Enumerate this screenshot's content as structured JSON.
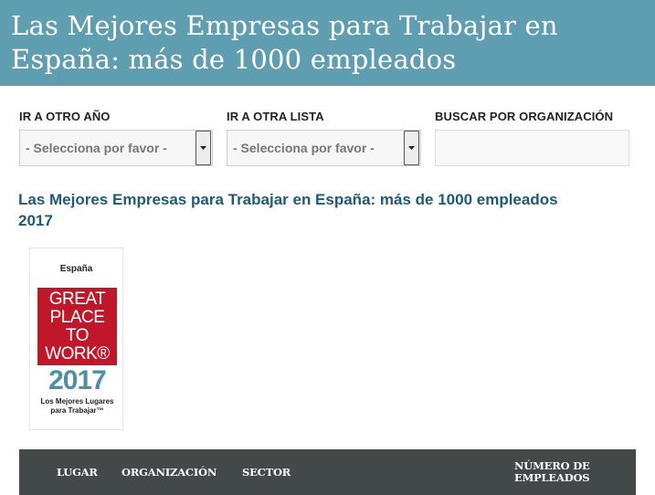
{
  "banner": {
    "title_line1": "Las Mejores Empresas para Trabajar en",
    "title_line2": "España: más de 1000 empleados"
  },
  "filters": {
    "year": {
      "label": "IR A OTRO AÑO",
      "selected": "- Selecciona por favor -"
    },
    "list": {
      "label": "IR A OTRA LISTA",
      "selected": "- Selecciona por favor -"
    },
    "search": {
      "label": "BUSCAR POR ORGANIZACIÓN",
      "value": ""
    }
  },
  "page": {
    "heading_line1": "Las Mejores Empresas para Trabajar en España: más de 1000 empleados",
    "heading_line2": "2017"
  },
  "logo": {
    "country": "España",
    "word1": "GREAT",
    "word2": "PLACE",
    "word3": "TO",
    "word4": "WORK®",
    "year": "2017",
    "tagline_line1": "Los Mejores Lugares",
    "tagline_line2": "para Trabajar™",
    "colors": {
      "red": "#c0182a",
      "teal": "#4f8fa3"
    }
  },
  "table": {
    "headers": {
      "lugar": "LUGAR",
      "organizacion": "ORGANIZACIÓN",
      "sector": "SECTOR",
      "empleados_line1": "NÚMERO DE",
      "empleados_line2": "EMPLEADOS"
    }
  },
  "colors": {
    "banner": "#5f9db0",
    "heading": "#1f5a78",
    "table_header": "#434848"
  }
}
